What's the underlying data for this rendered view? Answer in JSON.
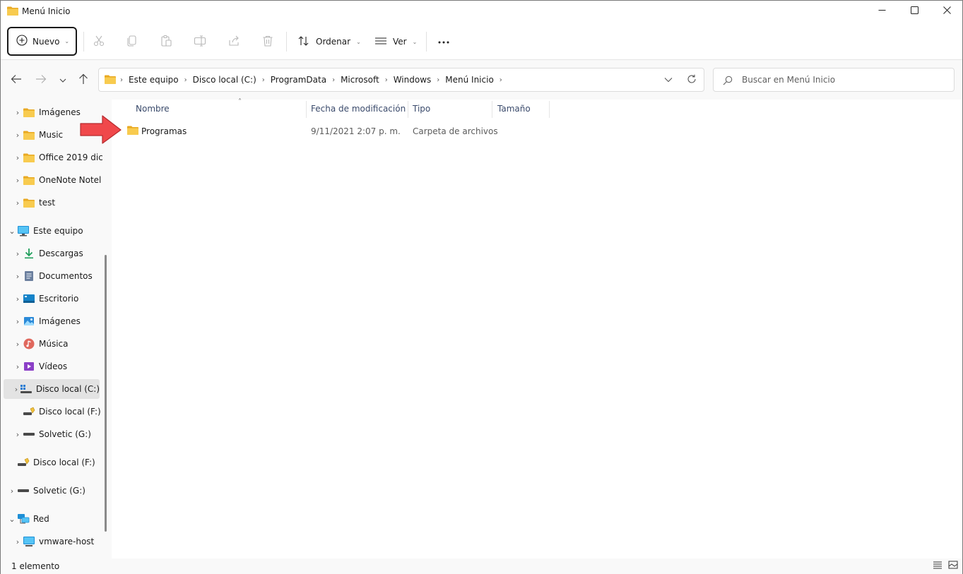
{
  "window": {
    "title": "Menú Inicio"
  },
  "toolbar": {
    "new_label": "Nuevo",
    "sort_label": "Ordenar",
    "view_label": "Ver"
  },
  "address": {
    "crumbs": [
      "Este equipo",
      "Disco local (C:)",
      "ProgramData",
      "Microsoft",
      "Windows",
      "Menú Inicio"
    ]
  },
  "search": {
    "placeholder": "Buscar en Menú Inicio"
  },
  "sidebar": {
    "items": [
      {
        "label": "Imágenes",
        "icon": "folder-icon"
      },
      {
        "label": "Music",
        "icon": "folder-icon"
      },
      {
        "label": "Office 2019 dic",
        "icon": "folder-icon"
      },
      {
        "label": "OneNote Notel",
        "icon": "folder-icon"
      },
      {
        "label": "test",
        "icon": "folder-icon"
      },
      {
        "label": "Este equipo",
        "icon": "computer-icon"
      },
      {
        "label": "Descargas",
        "icon": "download-icon"
      },
      {
        "label": "Documentos",
        "icon": "documents-icon"
      },
      {
        "label": "Escritorio",
        "icon": "desktop-icon"
      },
      {
        "label": "Imágenes",
        "icon": "pictures-icon"
      },
      {
        "label": "Música",
        "icon": "music-icon"
      },
      {
        "label": "Vídeos",
        "icon": "videos-icon"
      },
      {
        "label": "Disco local (C:)",
        "icon": "windows-drive-icon"
      },
      {
        "label": "Disco local (F:)",
        "icon": "usb-drive-icon"
      },
      {
        "label": "Solvetic (G:)",
        "icon": "drive-icon"
      },
      {
        "label": "Disco local (F:)",
        "icon": "usb-drive-icon"
      },
      {
        "label": "Solvetic (G:)",
        "icon": "drive-icon"
      },
      {
        "label": "Red",
        "icon": "network-icon"
      },
      {
        "label": "vmware-host",
        "icon": "network-computer-icon"
      }
    ]
  },
  "columns": {
    "name": "Nombre",
    "modified": "Fecha de modificación",
    "type": "Tipo",
    "size": "Tamaño"
  },
  "files": [
    {
      "name": "Programas",
      "modified": "9/11/2021 2:07 p. m.",
      "type": "Carpeta de archivos",
      "size": ""
    }
  ],
  "status": {
    "count": "1 elemento"
  },
  "colors": {
    "folder": "#f5c445",
    "arrow": "#f0484b",
    "accent": "#0067c0"
  }
}
